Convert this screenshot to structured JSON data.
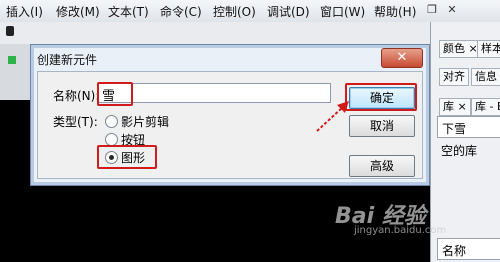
{
  "menubar": {
    "items": [
      "插入(I)",
      "修改(M)",
      "文本(T)",
      "命令(C)",
      "控制(O)",
      "调试(D)",
      "窗口(W)",
      "帮助(H)"
    ],
    "restore_glyph": "❐",
    "close_glyph": "✕"
  },
  "dialog": {
    "title": "创建新元件",
    "close_glyph": "✕",
    "name_label": "名称(N):",
    "name_value": "雪",
    "type_label": "类型(T):",
    "types": [
      "影片剪辑",
      "按钮",
      "图形"
    ],
    "selected_type": "图形",
    "ok_label": "确定",
    "cancel_label": "取消",
    "advanced_label": "高级"
  },
  "right_panel": {
    "tabs_row1": [
      "颜色 ×",
      "样本"
    ],
    "tabs_row2": [
      "对齐",
      "信息"
    ],
    "tabs_row3": [
      "库 ×",
      "库 - Bu"
    ],
    "library_name": "下雪",
    "empty_text": "空的库",
    "column_header": "名称"
  },
  "watermark": {
    "main": "Bai 经验",
    "sub": "jingyan.baidu.com"
  },
  "colors": {
    "highlight": "#d11b1b",
    "dialog_border": "#6a85a8",
    "primary_button": "#bee6fd"
  }
}
